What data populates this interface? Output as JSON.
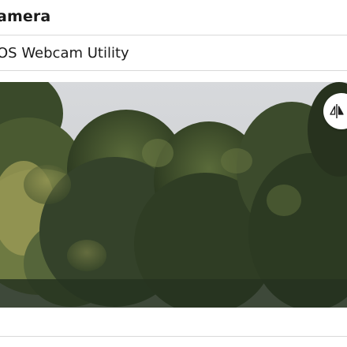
{
  "section": {
    "title": "Camera"
  },
  "camera": {
    "device_name": "iOS Webcam Utility"
  },
  "preview": {
    "scene": "trees-under-overcast-sky",
    "colors": {
      "sky": "#d3d5d8",
      "foliage_dark": "#2c3a22",
      "foliage_mid": "#4d5f33",
      "foliage_light": "#7e8a4a",
      "foliage_yellow": "#9a9a55"
    }
  },
  "controls": {
    "flip_icon": "flip-horizontal-icon"
  }
}
